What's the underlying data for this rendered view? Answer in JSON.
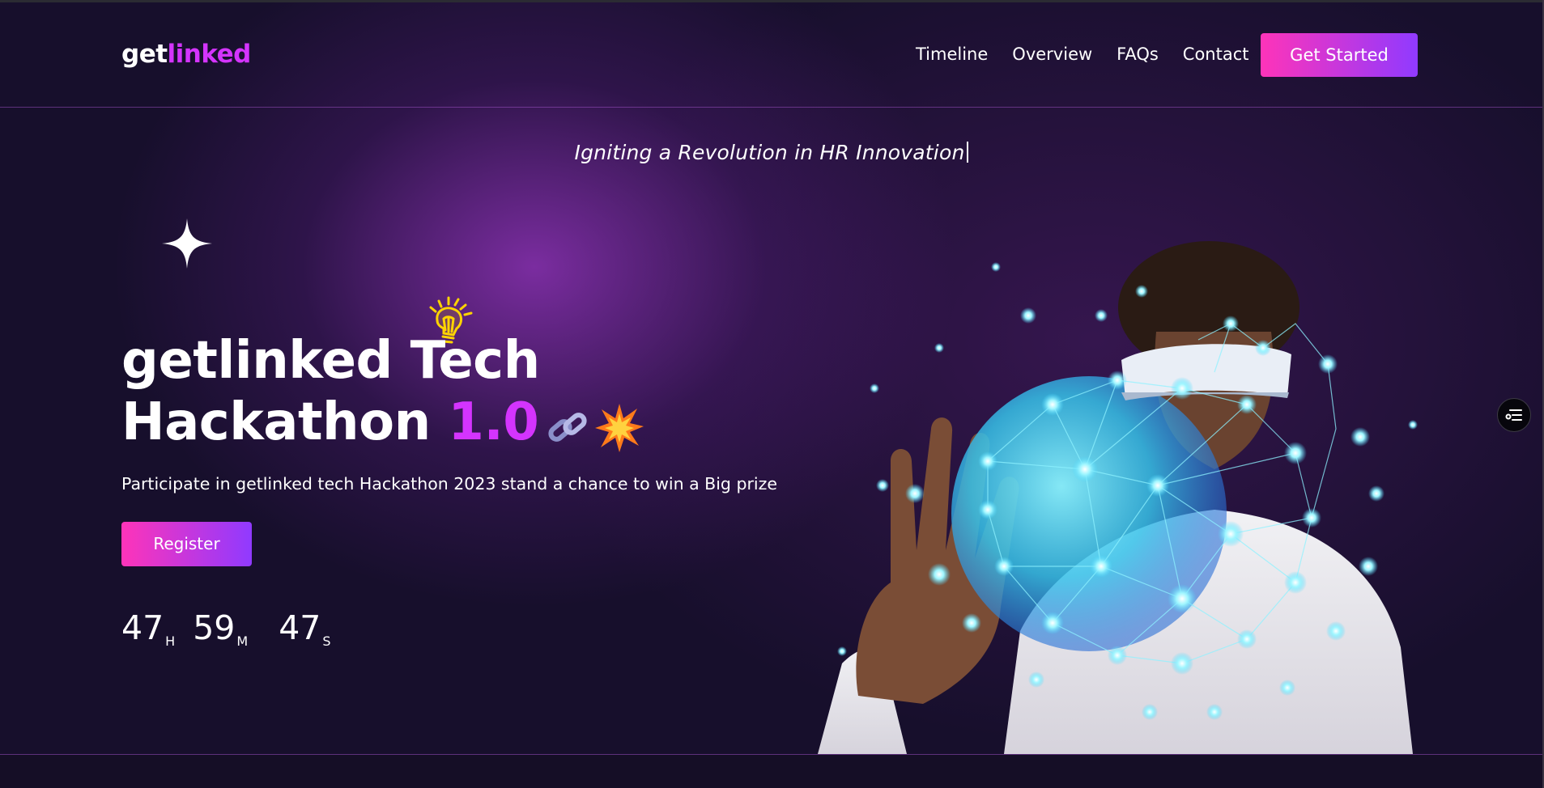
{
  "header": {
    "logo_part1": "get",
    "logo_part2": "linked",
    "nav": [
      "Timeline",
      "Overview",
      "FAQs",
      "Contact"
    ],
    "cta_label": "Get Started"
  },
  "hero": {
    "tagline": "Igniting a Revolution in HR Innovation",
    "title_line1": "getlinked Tech",
    "title_line2": "Hackathon",
    "title_version": "1.0",
    "subtitle": "Participate in getlinked tech Hackathon 2023 stand a chance to win a Big prize",
    "register_label": "Register",
    "countdown": {
      "hours": "47",
      "hours_unit": "H",
      "minutes": "59",
      "minutes_unit": "M",
      "seconds": "47",
      "seconds_unit": "S"
    }
  },
  "icons": {
    "star": "sparkle-star-icon",
    "bulb": "lightbulb-icon",
    "link": "chain-link-icon",
    "boom": "collision-icon",
    "fab": "filter-list-icon"
  },
  "colors": {
    "accent": "#d434fe",
    "button_start": "#fe34b9",
    "button_end": "#903aff",
    "background": "#150e28"
  }
}
